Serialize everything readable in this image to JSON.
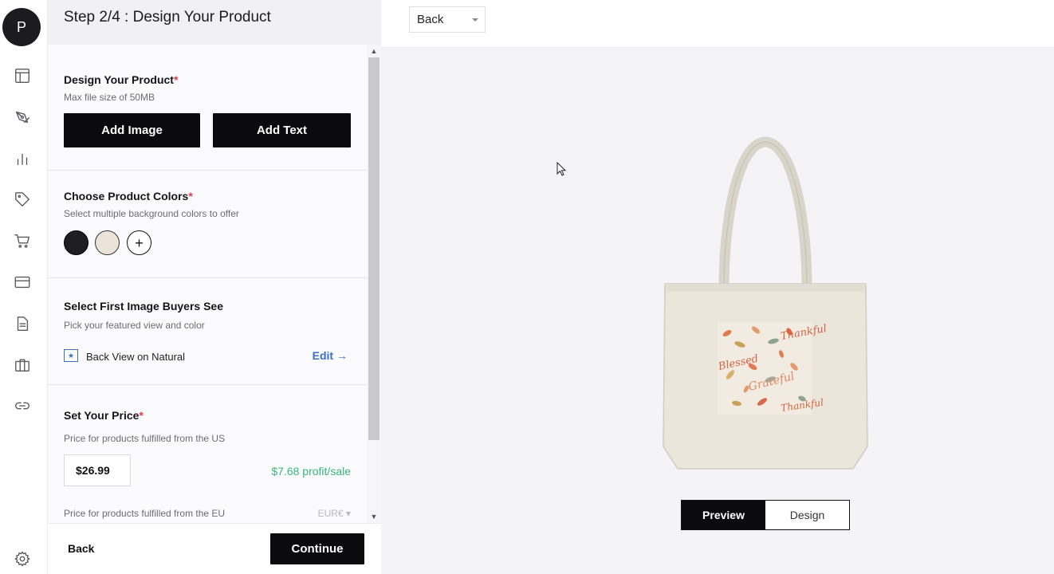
{
  "rail": {
    "avatar_letter": "P",
    "icons": [
      "dashboard-icon",
      "design-pen-icon",
      "analytics-icon",
      "tag-icon",
      "cart-icon",
      "card-icon",
      "document-icon",
      "briefcase-icon",
      "link-icon",
      "settings-icon"
    ]
  },
  "panel": {
    "title": "Step 2/4 : Design Your Product",
    "design": {
      "title": "Design Your Product",
      "required": "*",
      "subtitle": "Max file size of 50MB",
      "add_image": "Add Image",
      "add_text": "Add Text"
    },
    "colors": {
      "title": "Choose Product Colors",
      "required": "*",
      "subtitle": "Select multiple background colors to offer",
      "swatches": [
        {
          "name": "Black",
          "hex": "#1f1f22"
        },
        {
          "name": "Natural",
          "hex": "#ece4d8"
        }
      ],
      "add_symbol": "+"
    },
    "featured": {
      "title": "Select First Image Buyers See",
      "subtitle": "Pick your featured view and color",
      "selected": "Back View on Natural",
      "edit": "Edit →"
    },
    "price": {
      "title": "Set Your Price",
      "required": "*",
      "us_label": "Price for products fulfilled from the US",
      "us_value": "$26.99",
      "profit": "$7.68 profit/sale",
      "eu_label": "Price for products fulfilled from the EU",
      "eu_currency": "EUR€"
    },
    "footer": {
      "back": "Back",
      "continue": "Continue"
    }
  },
  "preview": {
    "view_select": "Back",
    "toggle": {
      "preview": "Preview",
      "design": "Design"
    },
    "print_words": [
      "Thankful",
      "Blessed",
      "Grateful",
      "Thankful"
    ]
  },
  "colors": {
    "accent_blue": "#3a6fc2",
    "profit_green": "#39b57a",
    "required_red": "#e23d4b",
    "primary_black": "#0b0b0d"
  }
}
